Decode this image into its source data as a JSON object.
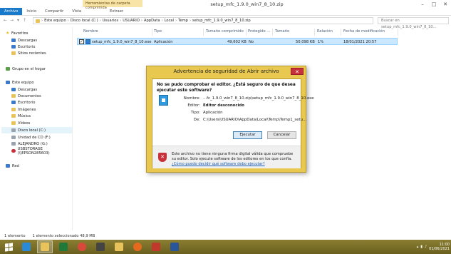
{
  "window": {
    "title": "setup_mfc_1.9.0_win7_8_10.zip",
    "context_tab": "Herramientas de carpeta comprimida",
    "controls": [
      "–",
      "□",
      "✕"
    ]
  },
  "ribbon": {
    "tabs": [
      "Archivo",
      "Inicio",
      "Compartir",
      "Vista"
    ],
    "context_tab": "Extraer"
  },
  "address": {
    "crumbs": [
      "Este equipo",
      "Disco local (C:)",
      "Usuarios",
      "USUARIO",
      "AppData",
      "Local",
      "Temp",
      "setup_mfc_1.9.0_win7_8_10.zip"
    ],
    "search_placeholder": "Buscar en setup_mfc_1.9.0_win7_8_10..."
  },
  "nav": {
    "favorites": "Favoritos",
    "fav_items": [
      "Descargas",
      "Escritorio",
      "Sitios recientes"
    ],
    "homegroup": "Grupo en el hogar",
    "this_pc": "Este equipo",
    "pc_items": [
      "Descargas",
      "Documentos",
      "Escritorio",
      "Imágenes",
      "Música",
      "Vídeos",
      "Disco local (C:)",
      "Unidad de CD (F:)",
      "ALEJANDRO (G:)",
      "USBSTORAGE (\\\\EPSON285603)"
    ],
    "network": "Red"
  },
  "columns": [
    "Nombre",
    "Tipo",
    "Tamaño comprimido",
    "Protegido ...",
    "Tamaño",
    "Relación",
    "Fecha de modificación"
  ],
  "file": {
    "name": "setup_mfc_1.9.0_win7_8_10.exe",
    "type": "Aplicación",
    "compressed": "49,602 KB",
    "protected": "No",
    "size": "50,098 KB",
    "ratio": "1%",
    "date": "18/01/2021 20:57"
  },
  "status": {
    "count": "1 elemento",
    "selected": "1 elemento seleccionado  48,9 MB"
  },
  "dialog": {
    "title": "Advertencia de seguridad de Abrir archivo",
    "warning": "No se pudo comprobar el editor. ¿Está seguro de que desea ejecutar este software?",
    "name_label": "Nombre:",
    "name_value": "...fc_1.9.0_win7_8_10.zip\\setup_mfc_1.9.0_win7_8_10.exe",
    "publisher_label": "Editor:",
    "publisher_value": "Editor desconocido",
    "type_label": "Tipo:",
    "type_value": "Aplicación",
    "from_label": "De:",
    "from_value": "C:\\Users\\USUARIO\\AppData\\Local\\Temp\\Temp1_setu...",
    "run_button": "Ejecutar",
    "cancel_button": "Cancelar",
    "footer_text": "Este archivo no tiene ninguna firma digital válida que compruebe su editor. Solo ejecute software de los editores en los que confía.",
    "footer_link": "¿Cómo puedo decidir qué software debo ejecutar?",
    "close": "✕"
  },
  "taskbar": {
    "time": "11:00",
    "date": "01/06/2021"
  }
}
